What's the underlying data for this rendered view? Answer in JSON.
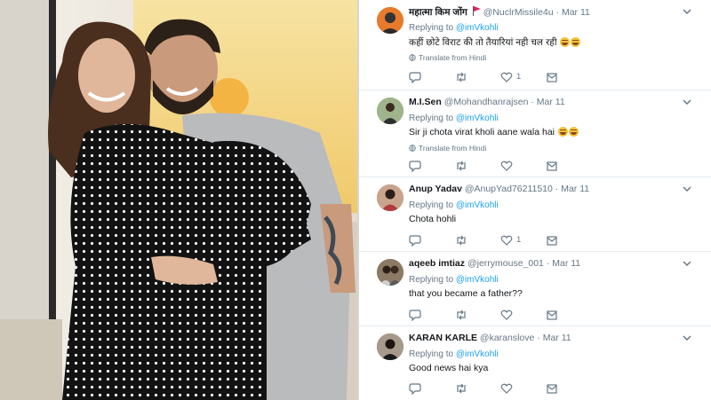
{
  "tweets": [
    {
      "name": "महात्मा किम जोंग",
      "handle": "@NuclrMissile4u",
      "date": "Mar 11",
      "replying_label": "Replying to",
      "replying_to": "@imVkohli",
      "text": "कहीं छोटे विराट की तो तैयारियां नही चल रही",
      "emoji_count": 2,
      "translate": "Translate from Hindi",
      "like_count": "1",
      "avatar_color": "#e87a2c"
    },
    {
      "name": "M.I.Sen",
      "handle": "@Mohandhanrajsen",
      "date": "Mar 11",
      "replying_label": "Replying to",
      "replying_to": "@imVkohli",
      "text": "Sir ji chota virat kholi aane wala hai",
      "emoji_count": 2,
      "translate": "Translate from Hindi",
      "like_count": "",
      "avatar_color": "#6d8a55"
    },
    {
      "name": "Anup Yadav",
      "handle": "@AnupYad76211510",
      "date": "Mar 11",
      "replying_label": "Replying to",
      "replying_to": "@imVkohli",
      "text": "Chota hohli",
      "emoji_count": 0,
      "translate": "",
      "like_count": "1",
      "avatar_color": "#8a5a44"
    },
    {
      "name": "aqeeb imtiaz",
      "handle": "@jerrymouse_001",
      "date": "Mar 11",
      "replying_label": "Replying to",
      "replying_to": "@imVkohli",
      "text": "that you became a father??",
      "emoji_count": 0,
      "translate": "",
      "like_count": "",
      "avatar_color": "#7a6a58"
    },
    {
      "name": "KARAN KARLE",
      "handle": "@karanslove",
      "date": "Mar 11",
      "replying_label": "Replying to",
      "replying_to": "@imVkohli",
      "text": "Good news hai kya",
      "emoji_count": 0,
      "translate": "",
      "like_count": "",
      "avatar_color": "#4a3b33"
    }
  ],
  "colors": {
    "link": "#1da1f2",
    "secondary_text": "#657786",
    "primary_text": "#14171a"
  },
  "icons": [
    "chevron-down-icon",
    "reply-icon",
    "retweet-icon",
    "like-icon",
    "share-icon",
    "globe-icon",
    "flag-icon"
  ]
}
